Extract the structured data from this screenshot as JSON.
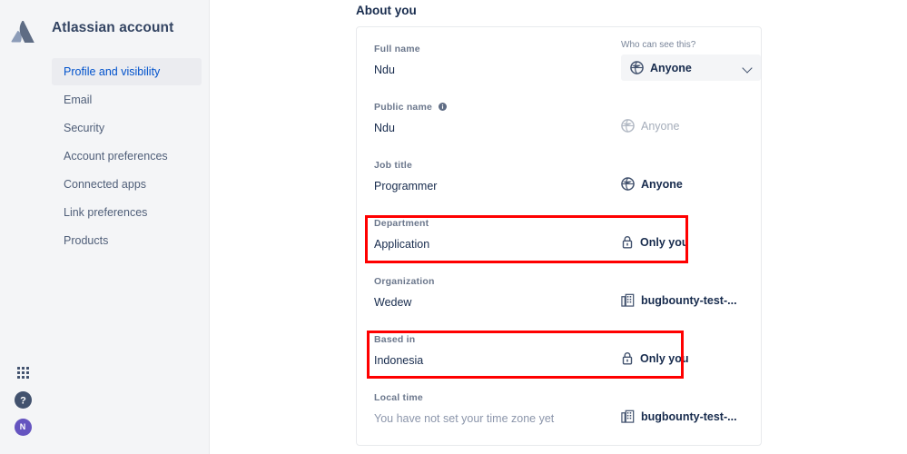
{
  "sidebar": {
    "brand": "Atlassian account",
    "logo_icon": "atlassian-logo-icon",
    "items": [
      {
        "label": "Profile and visibility",
        "active": true
      },
      {
        "label": "Email",
        "active": false
      },
      {
        "label": "Security",
        "active": false
      },
      {
        "label": "Account preferences",
        "active": false
      },
      {
        "label": "Connected apps",
        "active": false
      },
      {
        "label": "Link preferences",
        "active": false
      },
      {
        "label": "Products",
        "active": false
      }
    ],
    "footer_icons": [
      {
        "name": "app-switcher-grid-icon"
      },
      {
        "name": "help-circle-icon"
      },
      {
        "name": "user-avatar",
        "initial": "N",
        "color": "#6554C0"
      }
    ]
  },
  "main": {
    "page_title": "About you",
    "who_can_see_label": "Who can see this?",
    "fields": [
      {
        "label": "Full name",
        "value": "Ndu",
        "visibility": "Anyone",
        "visibility_icon": "globe-icon",
        "control": "select",
        "dim": false,
        "highlighted": false
      },
      {
        "label": "Public name",
        "value": "Ndu",
        "has_info_icon": true,
        "info_icon": "info-circle-icon",
        "visibility": "Anyone",
        "visibility_icon": "globe-icon",
        "control": "static",
        "dim": true,
        "highlighted": false
      },
      {
        "label": "Job title",
        "value": "Programmer",
        "visibility": "Anyone",
        "visibility_icon": "globe-icon",
        "control": "static",
        "dim": false,
        "highlighted": false
      },
      {
        "label": "Department",
        "value": "Application",
        "visibility": "Only you",
        "visibility_icon": "lock-icon",
        "control": "static",
        "dim": false,
        "highlighted": true
      },
      {
        "label": "Organization",
        "value": "Wedew",
        "visibility": "bugbounty-test-...",
        "visibility_icon": "building-icon",
        "control": "static",
        "dim": false,
        "highlighted": false
      },
      {
        "label": "Based in",
        "value": "Indonesia",
        "visibility": "Only you",
        "visibility_icon": "lock-icon",
        "control": "static",
        "dim": false,
        "highlighted": true
      },
      {
        "label": "Local time",
        "value": "You have not set your time zone yet",
        "value_muted": true,
        "visibility": "bugbounty-test-...",
        "visibility_icon": "building-icon",
        "control": "static",
        "dim": false,
        "highlighted": false
      }
    ]
  },
  "colors": {
    "sidebar_bg": "#F4F5F7",
    "active_item_bg": "#EBECF0",
    "active_item_text": "#0052CC",
    "text_primary": "#172B4D",
    "text_label": "#6B778C",
    "highlight_red": "#FF0000",
    "avatar_purple": "#6554C0"
  }
}
